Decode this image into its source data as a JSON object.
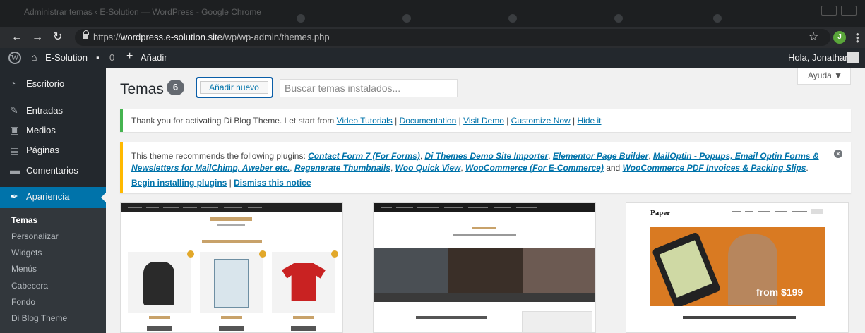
{
  "browser": {
    "tab_title": "Administrar temas ‹ E-Solution — WordPress - Google Chrome",
    "url_prefix": "https://",
    "url_host": "wordpress.e-solution.site",
    "url_path": "/wp/wp-admin/themes.php",
    "profile_initial": "J"
  },
  "adminbar": {
    "site_name": "E-Solution",
    "comments_count": "0",
    "add_label": "Añadir",
    "greeting": "Hola, Jonathan"
  },
  "sidebar": {
    "items": [
      {
        "label": "Escritorio",
        "icon": "dashboard-icon"
      },
      {
        "label": "Entradas",
        "icon": "pin-icon"
      },
      {
        "label": "Medios",
        "icon": "media-icon"
      },
      {
        "label": "Páginas",
        "icon": "pages-icon"
      },
      {
        "label": "Comentarios",
        "icon": "comments-icon"
      },
      {
        "label": "Apariencia",
        "icon": "brush-icon"
      }
    ],
    "submenu": [
      "Temas",
      "Personalizar",
      "Widgets",
      "Menús",
      "Cabecera",
      "Fondo",
      "Di Blog Theme"
    ]
  },
  "main": {
    "help_label": "Ayuda ▼",
    "page_title": "Temas",
    "theme_count": "6",
    "add_new_label": "Añadir nuevo",
    "search_placeholder": "Buscar temas instalados..."
  },
  "notice1": {
    "text": "Thank you for activating Di Blog Theme. Let start from",
    "links": [
      "Video Tutorials",
      "Documentation",
      "Visit Demo",
      "Customize Now",
      "Hide it"
    ]
  },
  "notice2": {
    "intro": "This theme recommends the following plugins:",
    "plugins": [
      "Contact Form 7 (For Forms)",
      "Di Themes Demo Site Importer",
      "Elementor Page Builder",
      "MailOptin - Popups, Email Optin Forms &",
      "Newsletters for MailChimp, Aweber etc.",
      "Regenerate Thumbnails",
      "Woo Quick View",
      "WooCommerce (For E-Commerce)",
      "WooCommerce PDF Invoices & Packing Slips"
    ],
    "and_word": "and",
    "begin_label": "Begin installing plugins",
    "dismiss_label": "Dismiss this notice"
  },
  "cards": {
    "paper_title": "Paper",
    "paper_price": "from $199"
  },
  "colors": {
    "admin_bg": "#23282d",
    "accent": "#0073aa",
    "success": "#46b450",
    "warning": "#ffb900"
  }
}
